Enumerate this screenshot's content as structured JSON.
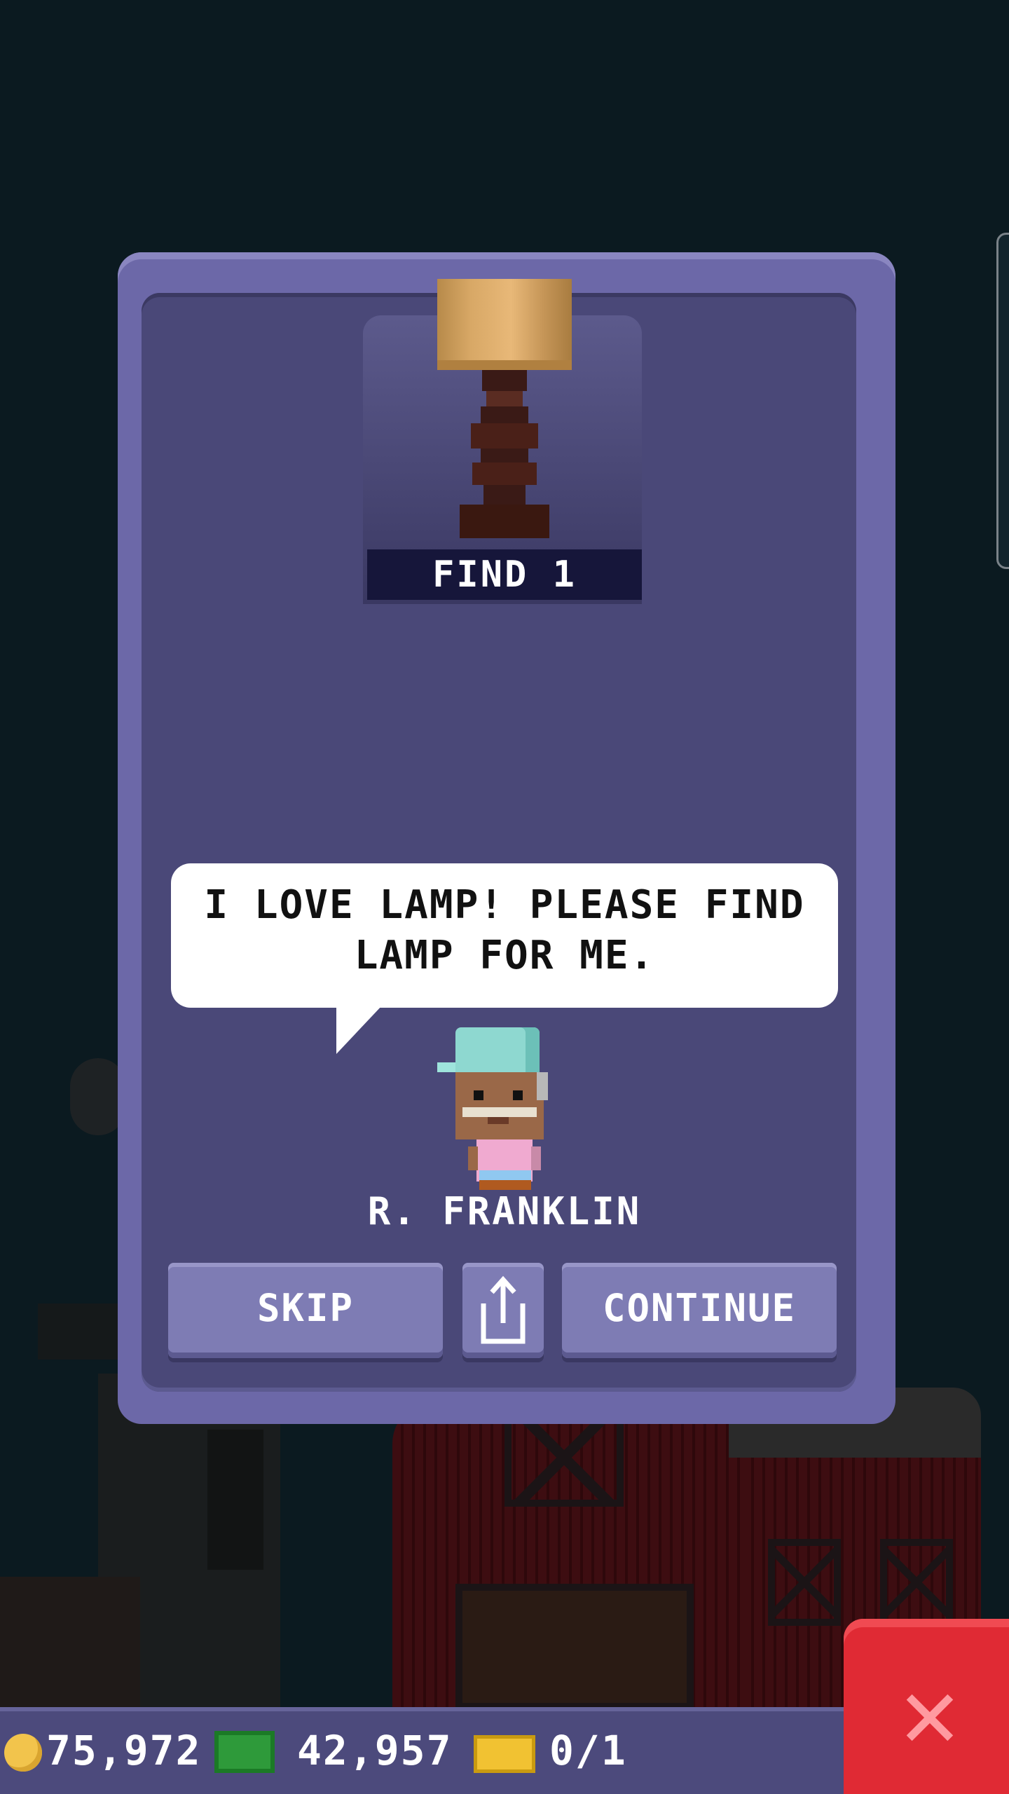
{
  "quest": {
    "find_label": "FIND 1",
    "speech": "I LOVE LAMP! PLEASE FIND LAMP FOR ME.",
    "npc_name": "R. FRANKLIN"
  },
  "buttons": {
    "skip": "SKIP",
    "continue": "CONTINUE"
  },
  "currency": {
    "coins": "75,972",
    "bux": "42,957",
    "tickets": "0/1"
  },
  "icons": {
    "item": "lamp-icon",
    "share": "share-icon",
    "coin": "coin-icon",
    "bux": "bux-icon",
    "ticket": "ticket-icon",
    "close": "close-icon"
  },
  "colors": {
    "modal": "#6c68a8",
    "close_button": "#e02a34",
    "background": "#0b1a20"
  }
}
